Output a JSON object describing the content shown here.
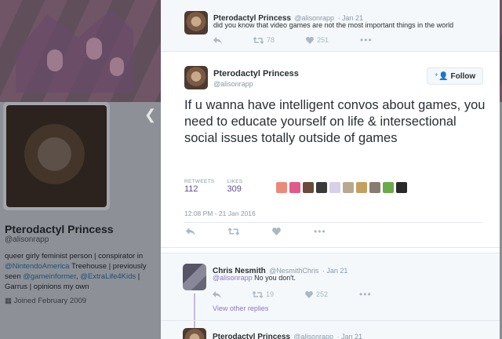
{
  "profile": {
    "name": "Pterodactyl Princess",
    "handle": "@alisonrapp",
    "bio_parts": [
      "queer girly feminist person | conspirator in ",
      "@NintendoAmerica",
      " Treehouse | previously seen ",
      "@gameinformer",
      ", ",
      "@ExtraLife4Kids",
      " | Garrus | opinions my own"
    ],
    "joined": "Joined February 2009"
  },
  "context_tweet": {
    "name": "Pterodactyl Princess",
    "handle": "@alisonrapp",
    "date": "· Jan 21",
    "text": "did you know that video games are not the most important things in the world",
    "retweets": "78",
    "likes": "251"
  },
  "main_tweet": {
    "name": "Pterodactyl Princess",
    "handle": "@alisonrapp",
    "follow_label": "Follow",
    "text": "If u wanna have intelligent convos about games, you need to educate yourself on life & intersectional social issues totally outside of games",
    "retweets_label": "RETWEETS",
    "retweets": "112",
    "likes_label": "LIKES",
    "likes": "309",
    "timestamp": "12:08 PM - 21 Jan 2016"
  },
  "reply": {
    "name": "Chris Nesmith",
    "handle": "@NesmithChris",
    "date": "· Jan 21",
    "mention": "@alisonrapp",
    "text": " No you don't.",
    "retweets": "19",
    "likes": "252",
    "view_other": "View other replies"
  },
  "reply2": {
    "name": "Pterodactyl Princess",
    "handle": "@alisonrapp",
    "date": "· Jan 21"
  },
  "colors": {
    "accent": "#5d4e8c",
    "link": "#8b76c7",
    "muted": "#8899a6"
  }
}
